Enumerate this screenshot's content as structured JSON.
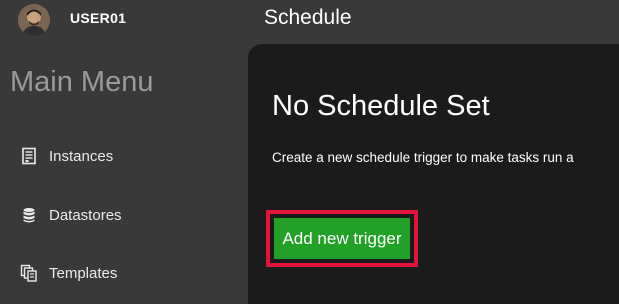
{
  "header": {
    "username": "USER01",
    "page_title": "Schedule",
    "avatar_icon": "user-avatar"
  },
  "sidebar": {
    "heading": "Main Menu",
    "items": [
      {
        "label": "Instances",
        "icon": "instances-icon"
      },
      {
        "label": "Datastores",
        "icon": "database-icon"
      },
      {
        "label": "Templates",
        "icon": "templates-icon"
      }
    ]
  },
  "main": {
    "empty_title": "No Schedule Set",
    "empty_description": "Create a new schedule trigger to make tasks run a",
    "add_button_label": "Add new trigger"
  },
  "colors": {
    "background": "#393939",
    "content_background": "#1b1b1b",
    "button_green": "#22a028",
    "highlight_red": "#e3143a",
    "heading_gray": "#9a9a9a"
  }
}
